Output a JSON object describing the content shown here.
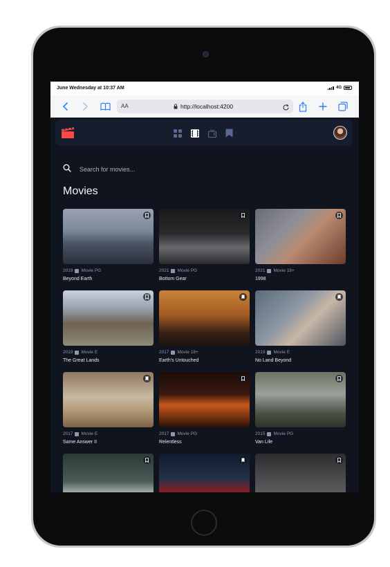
{
  "device": {
    "status_time": "June Wednesday at 10:37 AM",
    "network": "4G"
  },
  "browser": {
    "text_size_label": "AA",
    "url": "http://localhost:4200"
  },
  "nav": {
    "items": [
      "grid-icon",
      "film-icon",
      "tv-icon",
      "bookmark-icon"
    ],
    "accent_color": "#fc4747"
  },
  "search": {
    "placeholder": "Search for movies..."
  },
  "section": {
    "title": "Movies"
  },
  "movies": [
    {
      "year": "2019",
      "type": "Movie",
      "rating": "PG",
      "title": "Beyond Earth",
      "bookmarked": false
    },
    {
      "year": "2021",
      "type": "Movie",
      "rating": "PG",
      "title": "Bottom Gear",
      "bookmarked": false
    },
    {
      "year": "2021",
      "type": "Movie",
      "rating": "18+",
      "title": "1998",
      "bookmarked": false
    },
    {
      "year": "2019",
      "type": "Movie",
      "rating": "E",
      "title": "The Great Lands",
      "bookmarked": false
    },
    {
      "year": "2017",
      "type": "Movie",
      "rating": "18+",
      "title": "Earth's Untouched",
      "bookmarked": true
    },
    {
      "year": "2019",
      "type": "Movie",
      "rating": "E",
      "title": "No Land Beyond",
      "bookmarked": true
    },
    {
      "year": "2017",
      "type": "Movie",
      "rating": "E",
      "title": "Same Answer II",
      "bookmarked": true
    },
    {
      "year": "2017",
      "type": "Movie",
      "rating": "PG",
      "title": "Relentless",
      "bookmarked": false
    },
    {
      "year": "2015",
      "type": "Movie",
      "rating": "PG",
      "title": "Van Life",
      "bookmarked": false
    },
    {
      "year": "",
      "type": "",
      "rating": "",
      "title": "",
      "bookmarked": false
    },
    {
      "year": "",
      "type": "",
      "rating": "",
      "title": "",
      "bookmarked": true
    },
    {
      "year": "",
      "type": "",
      "rating": "",
      "title": "",
      "bookmarked": false
    }
  ]
}
